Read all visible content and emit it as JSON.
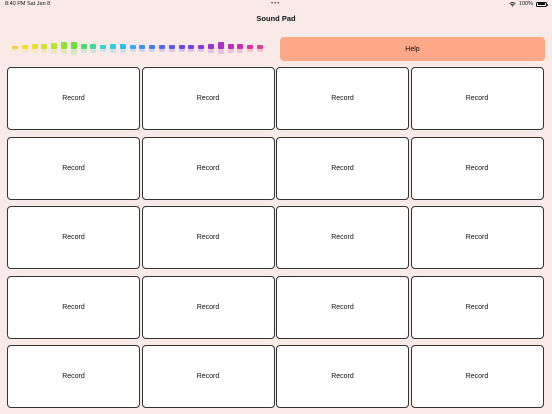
{
  "status_bar": {
    "time": "8:40 PM",
    "date": "Sat Jan 8",
    "multitask_dots": "•••",
    "battery_percent": "100%",
    "icons": [
      "wifi-icon",
      "battery-icon"
    ]
  },
  "header": {
    "title": "Sound Pad"
  },
  "level_meter": {
    "bars": [
      {
        "level": 0.25,
        "color": "#f7d23a"
      },
      {
        "level": 0.35,
        "color": "#f2dc2f"
      },
      {
        "level": 0.38,
        "color": "#e6e02c"
      },
      {
        "level": 0.4,
        "color": "#cfe32c"
      },
      {
        "level": 0.5,
        "color": "#b7e42e"
      },
      {
        "level": 0.55,
        "color": "#8ee233"
      },
      {
        "level": 0.62,
        "color": "#6bdd3b"
      },
      {
        "level": 0.45,
        "color": "#4fd96a"
      },
      {
        "level": 0.4,
        "color": "#3fd6a2"
      },
      {
        "level": 0.35,
        "color": "#35d2cf"
      },
      {
        "level": 0.38,
        "color": "#32cbe3"
      },
      {
        "level": 0.42,
        "color": "#33bbee"
      },
      {
        "level": 0.36,
        "color": "#37a8f3"
      },
      {
        "level": 0.32,
        "color": "#3c92f5"
      },
      {
        "level": 0.3,
        "color": "#437bf4"
      },
      {
        "level": 0.3,
        "color": "#4f66f1"
      },
      {
        "level": 0.3,
        "color": "#5b55ec"
      },
      {
        "level": 0.3,
        "color": "#6a48e6"
      },
      {
        "level": 0.32,
        "color": "#7a3fe0"
      },
      {
        "level": 0.36,
        "color": "#8b37d8"
      },
      {
        "level": 0.4,
        "color": "#9c32cf"
      },
      {
        "level": 0.55,
        "color": "#ad2fc4"
      },
      {
        "level": 0.45,
        "color": "#bd2eb8"
      },
      {
        "level": 0.4,
        "color": "#cc2fab"
      },
      {
        "level": 0.35,
        "color": "#d9339f"
      },
      {
        "level": 0.3,
        "color": "#e33a93"
      }
    ]
  },
  "help_button": {
    "label": "Help",
    "color": "#fda987"
  },
  "pads": [
    "Record",
    "Record",
    "Record",
    "Record",
    "Record",
    "Record",
    "Record",
    "Record",
    "Record",
    "Record",
    "Record",
    "Record",
    "Record",
    "Record",
    "Record",
    "Record",
    "Record",
    "Record",
    "Record",
    "Record"
  ]
}
